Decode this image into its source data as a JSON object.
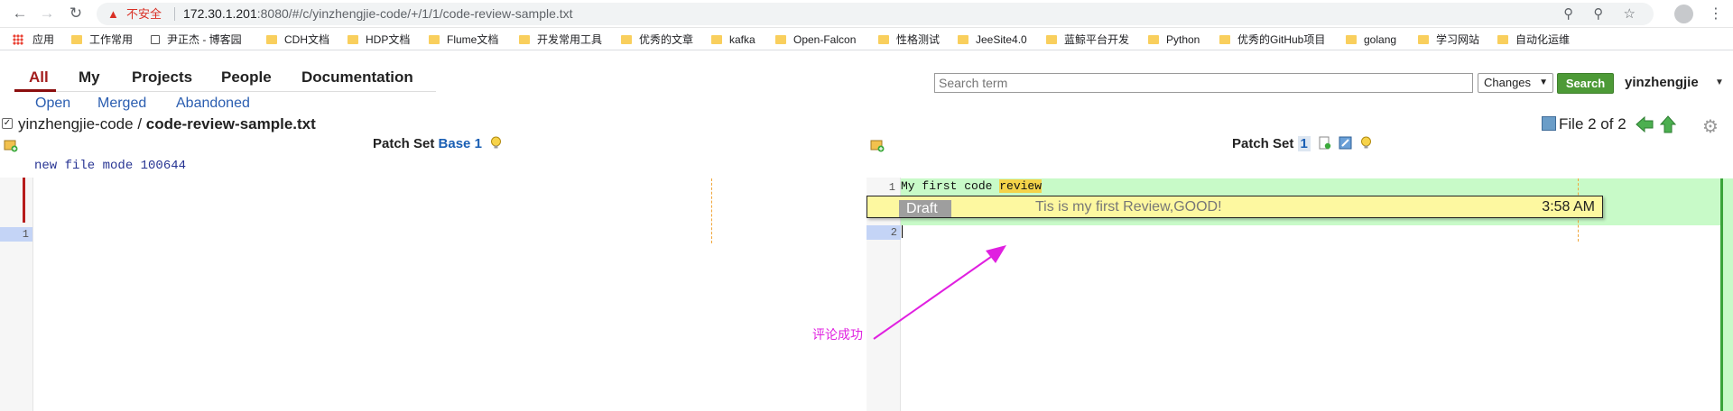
{
  "browser": {
    "insecure_label": "不安全",
    "url_host": "172.30.1.201",
    "url_path": ":8080/#/c/yinzhengjie-code/+/1/1/code-review-sample.txt"
  },
  "bookmarks": [
    "应用",
    "工作常用",
    "尹正杰 - 博客园",
    "CDH文档",
    "HDP文档",
    "Flume文档",
    "开发常用工具",
    "优秀的文章",
    "kafka",
    "Open-Falcon",
    "性格测试",
    "JeeSite4.0",
    "蓝鲸平台开发",
    "Python",
    "优秀的GitHub项目",
    "golang",
    "学习网站",
    "自动化运维"
  ],
  "nav": {
    "tabs": [
      "All",
      "My",
      "Projects",
      "People",
      "Documentation"
    ],
    "active_tab": "All",
    "subtabs": [
      "Open",
      "Merged",
      "Abandoned"
    ]
  },
  "search": {
    "placeholder": "Search term",
    "scope": "Changes",
    "button": "Search"
  },
  "user": {
    "name": "yinzhengjie"
  },
  "file": {
    "project": "yinzhengjie-code",
    "separator": " / ",
    "name": "code-review-sample.txt",
    "position": "File 2 of 2"
  },
  "left_pane": {
    "patch_set_label": "Patch Set",
    "patch_set_base": "Base",
    "patch_set_num": "1",
    "file_mode": "new file mode 100644",
    "line_numbers": [
      "1"
    ]
  },
  "right_pane": {
    "patch_set_label": "Patch Set",
    "patch_set_num": "1",
    "line1_prefix": "My first code ",
    "line1_highlight": "review",
    "line_numbers": [
      "1",
      "2"
    ]
  },
  "draft": {
    "badge": "Draft",
    "message": "Tis is my first Review,GOOD!",
    "time": "3:58 AM"
  },
  "annotation": {
    "text": "评论成功",
    "color": "#e020e0"
  },
  "colors": {
    "accent_tab": "#a31c1c",
    "search_button": "#4d9a37",
    "added_line_bg": "#c8fac8",
    "draft_bg": "#fdf8a0"
  }
}
